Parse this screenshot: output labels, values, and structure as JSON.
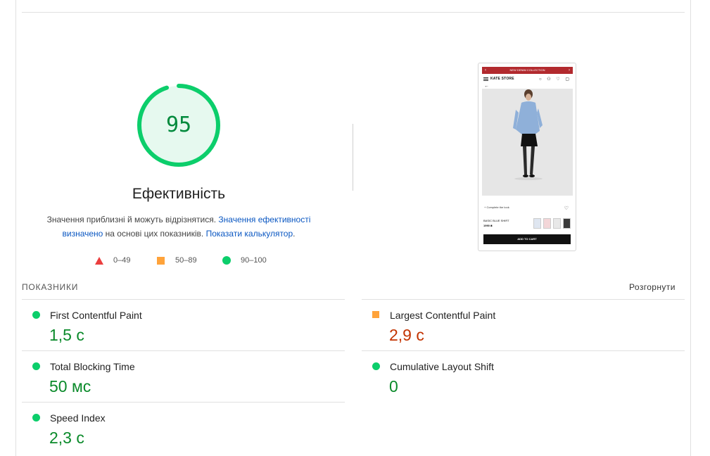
{
  "score": {
    "value": "95",
    "fraction": 0.95,
    "title": "Ефективність",
    "color": "#0cce6b",
    "bg": "#e6f9ef"
  },
  "description": {
    "text1": "Значення приблизні й можуть відрізнятися. ",
    "link1": "Значення ефективності визначено",
    "text2": " на основі цих показників. ",
    "link2": "Показати калькулятор",
    "text3": "."
  },
  "legend": [
    {
      "range": "0–49",
      "color": "#eb3e3e"
    },
    {
      "range": "50–89",
      "color": "#ffa33a"
    },
    {
      "range": "90–100",
      "color": "#0cce6b"
    }
  ],
  "thumbnail": {
    "banner": "NEW DENIM COLLECTION",
    "logo": "KATE STORE",
    "nav_icons": "○ ⚇ ♡ ▢",
    "complete_look": "+ Complete the look",
    "product_name": "BASIC BLUE SHIRT",
    "price": "1990 ₴",
    "add_to_cart": "ADD TO CART"
  },
  "metrics_section": {
    "title": "ПОКАЗНИКИ",
    "expand_label": "Розгорнути"
  },
  "metrics": [
    {
      "name": "First Contentful Paint",
      "value": "1,5 с",
      "status": "good"
    },
    {
      "name": "Largest Contentful Paint",
      "value": "2,9 с",
      "status": "average"
    },
    {
      "name": "Total Blocking Time",
      "value": "50 мс",
      "status": "good"
    },
    {
      "name": "Cumulative Layout Shift",
      "value": "0",
      "status": "good"
    },
    {
      "name": "Speed Index",
      "value": "2,3 с",
      "status": "good"
    }
  ]
}
